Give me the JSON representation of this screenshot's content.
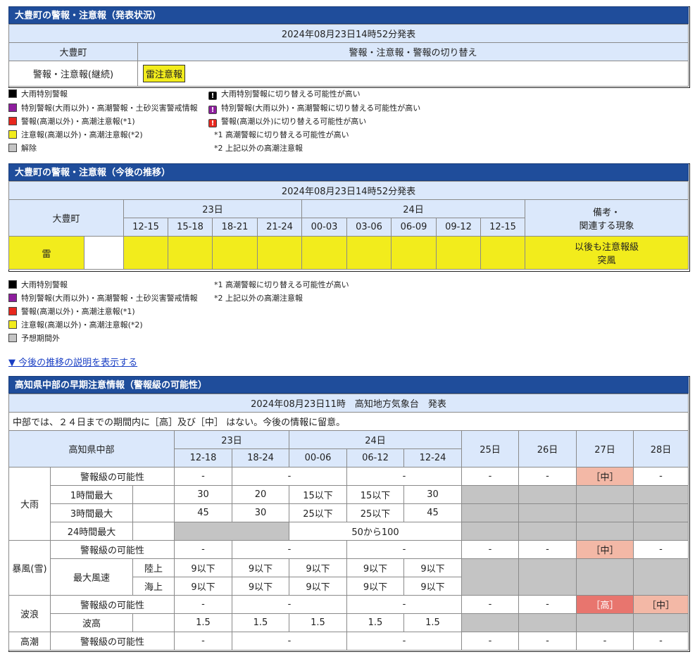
{
  "sec1": {
    "title": "大豊町の警報・注意報（発表状況）",
    "issued": "2024年08月23日14時52分発表",
    "col1": "大豊町",
    "col2": "警報・注意報・警報の切り替え",
    "row_label": "警報・注意報(継続)",
    "badge": "雷注意報"
  },
  "legend1": {
    "left": [
      "大雨特別警報",
      "特別警報(大雨以外)・高潮警報・土砂災害警戒情報",
      "警報(高潮以外)・高潮注意報(*1)",
      "注意報(高潮以外)・高潮注意報(*2)",
      "解除"
    ],
    "right": [
      "大雨特別警報に切り替える可能性が高い",
      "特別警報(大雨以外)・高潮警報に切り替える可能性が高い",
      "警報(高潮以外)に切り替える可能性が高い",
      "*1 高潮警報に切り替える可能性が高い",
      "*2 上記以外の高潮注意報"
    ]
  },
  "sec2": {
    "title": "大豊町の警報・注意報（今後の推移）",
    "issued": "2024年08月23日14時52分発表",
    "area": "大豊町",
    "day1": "23日",
    "day2": "24日",
    "times": [
      "12-15",
      "15-18",
      "18-21",
      "21-24",
      "00-03",
      "03-06",
      "06-09",
      "09-12",
      "12-15"
    ],
    "remarks_head1": "備考・",
    "remarks_head2": "関連する現象",
    "row_label": "雷",
    "remark1": "以後も注意報級",
    "remark2": "突風"
  },
  "legend2": {
    "left": [
      "大雨特別警報",
      "特別警報(大雨以外)・高潮警報・土砂災害警戒情報",
      "警報(高潮以外)・高潮注意報(*1)",
      "注意報(高潮以外)・高潮注意報(*2)",
      "予想期間外"
    ],
    "right": [
      "*1 高潮警報に切り替える可能性が高い",
      "*2 上記以外の高潮注意報"
    ]
  },
  "link": "▼ 今後の推移の説明を表示する",
  "sec3": {
    "title": "高知県中部の早期注意情報（警報級の可能性）",
    "issued": "2024年08月23日11時　高知地方気象台　発表",
    "note": "中部では、２４日までの期間内に［高］及び［中］ はない。今後の情報に留意。",
    "area": "高知県中部",
    "day23": "23日",
    "day24": "24日",
    "times": [
      "12-18",
      "18-24",
      "00-06",
      "06-12",
      "12-24"
    ],
    "days": [
      "25日",
      "26日",
      "27日",
      "28日"
    ],
    "rain": "大雨",
    "wind": "暴風(雪)",
    "wave": "波浪",
    "surge": "高潮",
    "possibility": "警報級の可能性",
    "r1h": "1時間最大",
    "r3h": "3時間最大",
    "r24h": "24時間最大",
    "max_wind": "最大風速",
    "land": "陸上",
    "sea": "海上",
    "wave_height": "波高",
    "dash": "-",
    "mid": "［中］",
    "high": "［高］",
    "r1_vals": [
      "30",
      "20",
      "15以下",
      "15以下",
      "30"
    ],
    "r3_vals": [
      "45",
      "30",
      "25以下",
      "25以下",
      "45"
    ],
    "r24_val": "50から100",
    "land_vals": [
      "9以下",
      "9以下",
      "9以下",
      "9以下",
      "9以下"
    ],
    "sea_vals": [
      "9以下",
      "9以下",
      "9以下",
      "9以下",
      "9以下"
    ],
    "wave_vals": [
      "1.5",
      "1.5",
      "1.5",
      "1.5",
      "1.5"
    ]
  },
  "colors": {
    "title_bg": "#1f4d9b",
    "label_bg": "#dbe8fb",
    "yellow": "#f2ec1c",
    "black": "#000000",
    "purple": "#8e1e9e",
    "red": "#e8281e",
    "gray": "#c4c4c4",
    "mid_pink": "#f3b8a6",
    "high_red": "#e8756e"
  }
}
